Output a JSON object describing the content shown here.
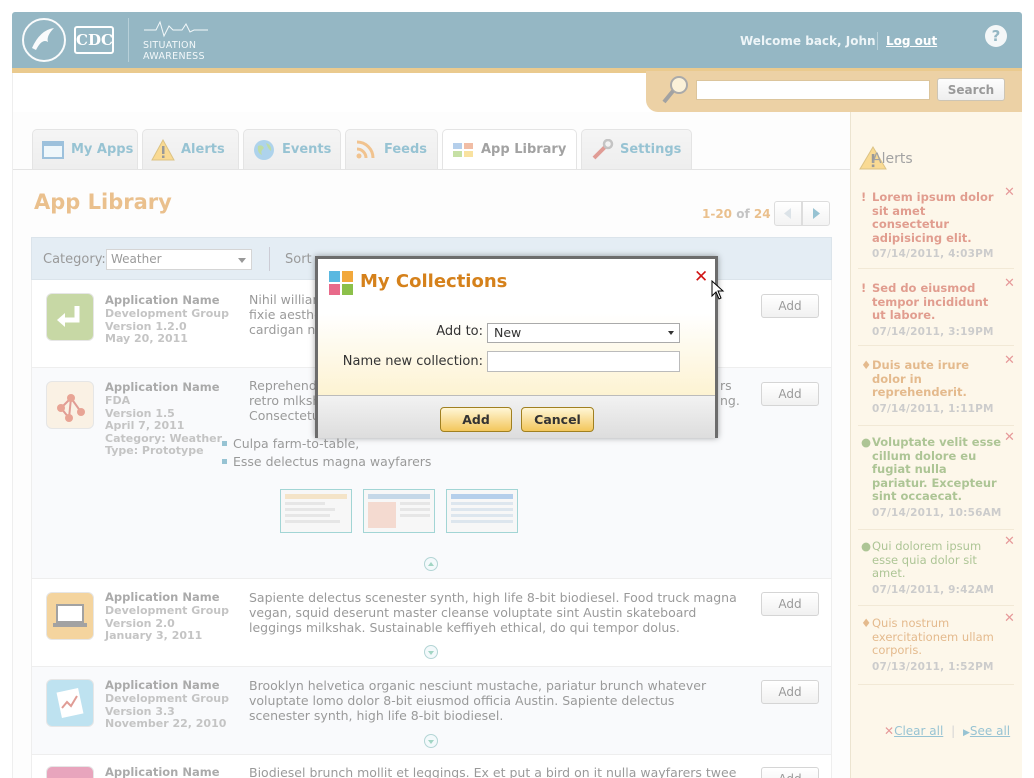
{
  "header": {
    "logo_cdc": "CDC",
    "situation_line1": "SITUATION",
    "situation_line2": "AWARENESS",
    "welcome": "Welcome back, John",
    "logout": "Log out",
    "help": "?"
  },
  "search": {
    "button": "Search",
    "placeholder": ""
  },
  "tabs": [
    {
      "label": "My Apps",
      "icon": "window-icon"
    },
    {
      "label": "Alerts",
      "icon": "warning-icon"
    },
    {
      "label": "Events",
      "icon": "globe-icon"
    },
    {
      "label": "Feeds",
      "icon": "rss-icon"
    },
    {
      "label": "App Library",
      "icon": "grid-icon",
      "active": true
    },
    {
      "label": "Settings",
      "icon": "wrench-icon"
    }
  ],
  "page_title": "App Library",
  "pager": {
    "range": "1-20",
    "of": "of",
    "total": "24"
  },
  "filter": {
    "category_label": "Category:",
    "category_value": "Weather",
    "sort_label": "Sort"
  },
  "apps": [
    {
      "name": "Application Name",
      "group": "Development Group",
      "version": "Version 1.2.0",
      "date": "May 20, 2011",
      "desc": "Nihil william",
      "desc2": "fixie aesthe",
      "desc3": "cardigan no",
      "add": "Add",
      "icon_color": "#8fb04a"
    },
    {
      "name": "Application Name",
      "group": "FDA",
      "version": "Version 1.5",
      "date": "April 7, 2011",
      "category": "Category: Weather",
      "type": "Type: Prototype",
      "desc": "Reprehende",
      "desc2": "retro mlksh",
      "desc3": "Consectetu",
      "desc_right1": "rs",
      "desc_right2": "ng.",
      "bullets": [
        "Culpa farm-to-table,",
        "Esse delectus magna wayfarers"
      ],
      "add": "Add",
      "icon_color": "#f5e2c8"
    },
    {
      "name": "Application Name",
      "group": "Development Group",
      "version": "Version 2.0",
      "date": "January 3, 2011",
      "desc": "Sapiente delectus scenester synth, high life 8-bit biodiesel. Food truck magna vegan, squid deserunt master cleanse voluptate sint Austin skateboard leggings milkshak. Sustainable keffiyeh ethical, do qui tempor dolus.",
      "add": "Add",
      "icon_color": "#e8a93c"
    },
    {
      "name": "Application Name",
      "group": "Development Group",
      "version": "Version 3.3",
      "date": "November 22, 2010",
      "desc": "Brooklyn helvetica organic nesciunt mustache, pariatur brunch whatever voluptate lomo dolor 8-bit eiusmod officia Austin. Sapiente delectus scenester synth, high life 8-bit biodiesel.",
      "add": "Add",
      "icon_color": "#7cc4e0"
    },
    {
      "name": "Application Name",
      "desc": "Biodiesel brunch mollit et leggings. Ex et put a bird on it nulla wayfarers twee",
      "add": "Add",
      "icon_color": "#d04a7a"
    }
  ],
  "sidebar": {
    "title": "Alerts",
    "alerts": [
      {
        "mark": "!",
        "color": "#c33a1e",
        "text": "Lorem ipsum dolor sit amet consectetur adipisicing elit.",
        "time": "07/14/2011, 4:03PM"
      },
      {
        "mark": "!",
        "color": "#c33a1e",
        "text": "Sed do eiusmod tempor incididunt ut labore.",
        "time": "07/14/2011, 3:19PM"
      },
      {
        "mark": "♦",
        "color": "#c8741a",
        "text": "Duis aute irure dolor in reprehenderit.",
        "time": "07/14/2011, 1:11PM"
      },
      {
        "mark": "●",
        "color": "#5a8a2a",
        "text": "Voluptate velit esse cillum dolore eu fugiat nulla pariatur. Excepteur sint occaecat.",
        "time": "07/14/2011, 10:56AM"
      },
      {
        "mark": "●",
        "color": "#5a8a2a",
        "text": "Qui dolorem ipsum esse quia dolor sit amet.",
        "time": "07/14/2011, 9:42AM"
      },
      {
        "mark": "♦",
        "color": "#c8741a",
        "text": "Quis nostrum exercitationem ullam corporis.",
        "time": "07/13/2011, 1:52PM"
      }
    ],
    "clear_all": "Clear all",
    "see_all": "See all"
  },
  "modal": {
    "title": "My Collections",
    "add_to_label": "Add to:",
    "add_to_value": "New",
    "name_label": "Name new collection:",
    "name_value": "",
    "add_button": "Add",
    "cancel_button": "Cancel",
    "close": "✕"
  }
}
